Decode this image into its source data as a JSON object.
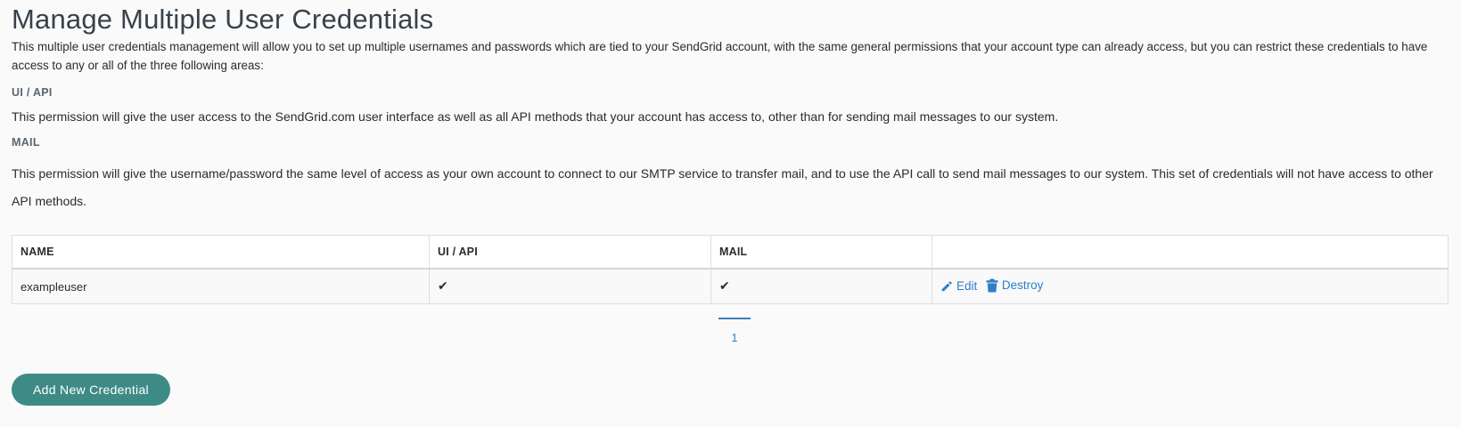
{
  "header": {
    "title": "Manage Multiple User Credentials"
  },
  "intro": "This multiple user credentials management will allow you to set up multiple usernames and passwords which are tied to your SendGrid account, with the same general permissions that your account type can already access, but you can restrict these credentials to have access to any or all of the three following areas:",
  "permissions": [
    {
      "title": "UI / API",
      "description": "This permission will give the user access to the SendGrid.com user interface as well as all API methods that your account has access to, other than for sending mail messages to our system."
    },
    {
      "title": "MAIL",
      "description": "This permission will give the username/password the same level of access as your own account to connect to our SMTP service to transfer mail, and to use the API call to send mail messages to our system. This set of credentials will not have access to other API methods."
    }
  ],
  "table": {
    "headers": [
      "NAME",
      "UI / API",
      "MAIL",
      ""
    ],
    "rows": [
      {
        "name": "exampleuser",
        "ui_api": "✔",
        "mail": "✔",
        "edit_label": "Edit",
        "destroy_label": "Destroy"
      }
    ]
  },
  "pagination": {
    "current_page": "1"
  },
  "actions": {
    "add_label": "Add New Credential"
  },
  "colors": {
    "accent": "#3e8a86",
    "link": "#2f7fc6"
  },
  "icons": {
    "edit": "pencil-icon",
    "destroy": "trash-icon",
    "checkmark": "checkmark-icon"
  }
}
